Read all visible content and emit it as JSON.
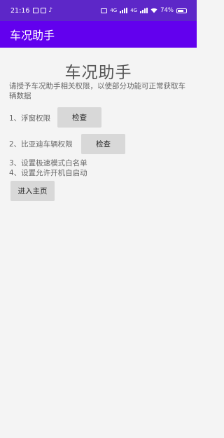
{
  "status_bar": {
    "time": "21:16",
    "battery": "74%",
    "battery_level": 0.74,
    "network_labels": [
      "4G",
      "4G"
    ]
  },
  "app_bar": {
    "title": "车况助手"
  },
  "main": {
    "heading": "车况助手",
    "description": "请授予车况助手相关权限，以使部分功能可正常获取车辆数据",
    "steps": [
      {
        "label": "1、浮窗权限",
        "button": "检查"
      },
      {
        "label": "2、比亚迪车辆权限",
        "button": "检查"
      },
      {
        "label": "3、设置极速模式白名单"
      },
      {
        "label": "4、设置允许开机自启动"
      }
    ],
    "enter_button": "进入主页"
  },
  "colors": {
    "status_bar": "#5d27c8",
    "app_bar": "#6200ee",
    "button_bg": "#d8d8d8",
    "page_bg": "#f4f4f4"
  }
}
